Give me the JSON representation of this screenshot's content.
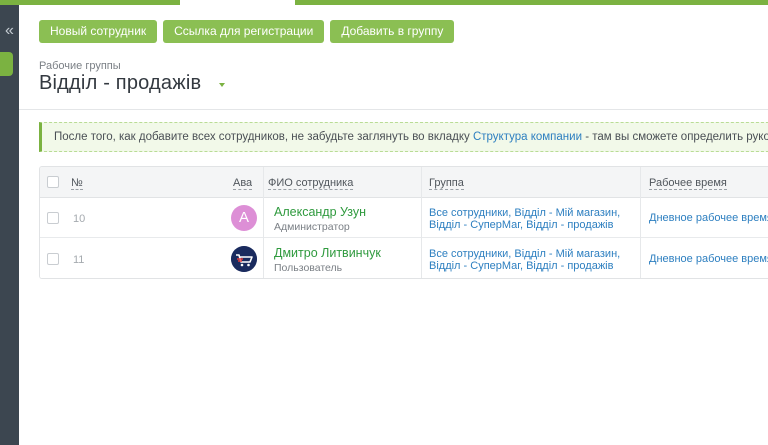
{
  "sidebar": {
    "collapse_glyph": "«"
  },
  "toolbar": {
    "buttons": [
      "Новый сотрудник",
      "Ссылка для регистрации",
      "Добавить в группу"
    ]
  },
  "header": {
    "crumb_label": "Рабочие группы",
    "title": "Відділ - продажів"
  },
  "notice": {
    "text_before": "После того, как добавите всех сотрудников, не забудьте заглянуть во вкладку ",
    "link": "Структура компании",
    "text_after": " - там вы сможете определить руководителей"
  },
  "table": {
    "columns": [
      "№",
      "Аватар",
      "ФИО сотрудника",
      "Группа",
      "Рабочее время"
    ],
    "rows": [
      {
        "num": "10",
        "avatar_letter": "A",
        "name": "Александр Узун",
        "role": "Администратор",
        "groups": "Все сотрудники, Відділ - Мій магазин, Відділ - СуперМаг, Відділ - продажів",
        "worktime": "Дневное рабочее время"
      },
      {
        "num": "11",
        "avatar_icon": "cart-logo-icon",
        "name": "Дмитро Литвинчук",
        "role": "Пользователь",
        "groups": "Все сотрудники, Відділ - Мій магазин, Відділ - СуперМаг, Відділ - продажів",
        "worktime": "Дневное рабочее время"
      }
    ]
  },
  "colors": {
    "accent_green": "#7bb241",
    "button_green": "#8bbf53",
    "link_blue": "#2d7fc0",
    "name_green": "#2f9a3e",
    "rail_dark": "#3c4650"
  }
}
